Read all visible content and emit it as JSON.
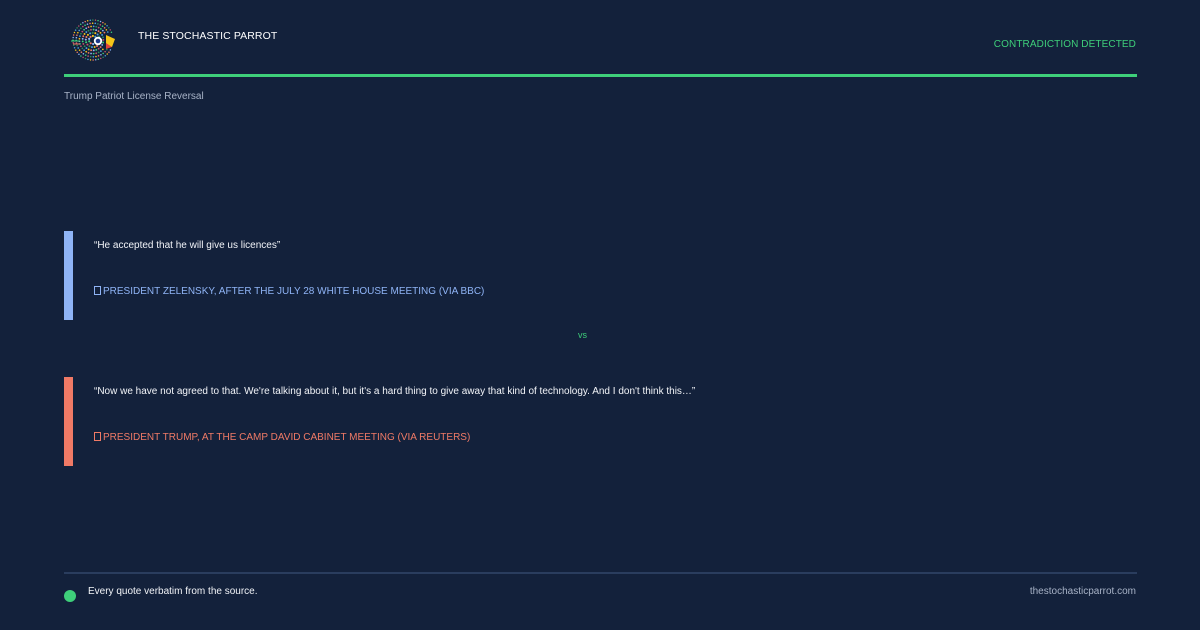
{
  "header": {
    "logo": "parrot-logo",
    "brand": "THE STOCHASTIC PARROT",
    "status": "CONTRADICTION DETECTED"
  },
  "topic": "Trump Patriot License Reversal",
  "quotes": [
    {
      "text": "“He accepted that he will give us licences”",
      "attribution": "PRESIDENT ZELENSKY, AFTER THE JULY 28 WHITE HOUSE MEETING (VIA BBC)",
      "color": "#8fb4f6"
    },
    {
      "text": "“Now we have not agreed to that. We're talking about it, but it's a hard thing to give away that kind of technology. And I don't think this…”",
      "attribution": "PRESIDENT TRUMP, AT THE CAMP DAVID CABINET MEETING (VIA REUTERS)",
      "color": "#f07a66"
    }
  ],
  "separator": "vs",
  "footer": {
    "disclaimer": "Every quote verbatim from the source.",
    "site": "thestochasticparrot.com"
  },
  "colors": {
    "background": "#13213b",
    "accent": "#3ecf7a",
    "quote1": "#8fb4f6",
    "quote2": "#f07a66"
  }
}
